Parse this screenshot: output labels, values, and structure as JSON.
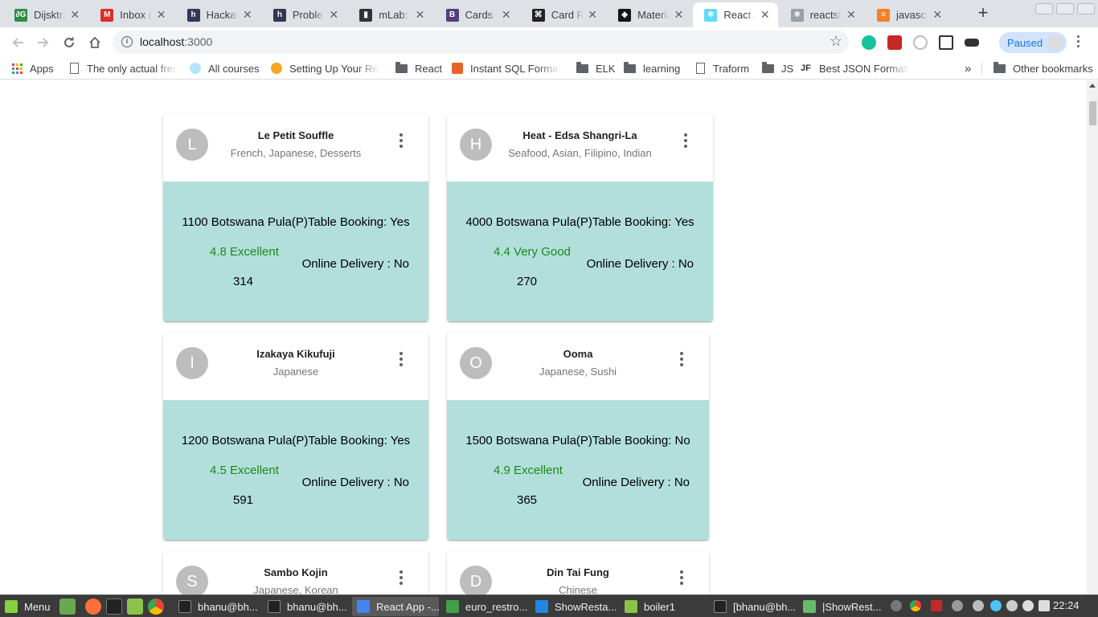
{
  "browser": {
    "tabs": [
      {
        "title": "Dijsktra",
        "favicon": "geeksforgeeks-icon",
        "color": "#2f8d46",
        "glyph": "∂G"
      },
      {
        "title": "Inbox (2",
        "favicon": "gmail-icon",
        "color": "#d93025",
        "glyph": "M"
      },
      {
        "title": "Hackath",
        "favicon": "hackerearth-icon",
        "color": "#323754",
        "glyph": "h"
      },
      {
        "title": "Problem",
        "favicon": "hackerearth-icon",
        "color": "#323754",
        "glyph": "h"
      },
      {
        "title": "mLab: C",
        "favicon": "mlab-icon",
        "color": "#333",
        "glyph": "▮"
      },
      {
        "title": "Cards - I",
        "favicon": "bootstrap-icon",
        "color": "#563d7c",
        "glyph": "B"
      },
      {
        "title": "Card Re",
        "favicon": "github-icon",
        "color": "#222",
        "glyph": "⌘"
      },
      {
        "title": "Materia",
        "favicon": "codesandbox-icon",
        "color": "#151515",
        "glyph": "◈"
      },
      {
        "title": "React A",
        "favicon": "react-icon",
        "color": "#61dafb",
        "glyph": "⚛",
        "active": true
      },
      {
        "title": "reactstr",
        "favicon": "react-icon",
        "color": "#9aa0a6",
        "glyph": "⚛"
      },
      {
        "title": "javascri",
        "favicon": "stackoverflow-icon",
        "color": "#f48024",
        "glyph": "≡"
      }
    ],
    "url_host": "localhost",
    "url_port": ":3000",
    "profile_label": "Paused",
    "bookmarks": [
      {
        "label": "Apps",
        "icon": "apps-grid-icon"
      },
      {
        "label": "The only actual free",
        "icon": "page-icon"
      },
      {
        "label": "All courses",
        "icon": "idea-icon"
      },
      {
        "label": "Setting Up Your Rea",
        "icon": "orange-icon"
      },
      {
        "label": "React",
        "icon": "folder-icon"
      },
      {
        "label": "Instant SQL Formatt",
        "icon": "sql-icon"
      },
      {
        "label": "ELK",
        "icon": "folder-icon"
      },
      {
        "label": "learning",
        "icon": "folder-icon"
      },
      {
        "label": "Traform",
        "icon": "page-icon"
      },
      {
        "label": "JS",
        "icon": "folder-icon"
      },
      {
        "label": "Best JSON Formatte",
        "icon": "jsonformatter-icon"
      }
    ],
    "bookmarks_overflow": "»",
    "other_bookmarks": "Other bookmarks"
  },
  "restaurants": [
    {
      "initial": "L",
      "name": "Le Petit Souffle",
      "cuisines": "French, Japanese, Desserts",
      "price_line": "1100 Botswana Pula(P)Table Booking: Yes",
      "rating": "4.8 Excellent",
      "delivery": "Online Delivery : No",
      "votes": "314"
    },
    {
      "initial": "H",
      "name": "Heat - Edsa Shangri-La",
      "cuisines": "Seafood, Asian, Filipino, Indian",
      "price_line": "4000 Botswana Pula(P)Table Booking: Yes",
      "rating": "4.4 Very Good",
      "delivery": "Online Delivery : No",
      "votes": "270"
    },
    {
      "initial": "I",
      "name": "Izakaya Kikufuji",
      "cuisines": "Japanese",
      "price_line": "1200 Botswana Pula(P)Table Booking: Yes",
      "rating": "4.5 Excellent",
      "delivery": "Online Delivery : No",
      "votes": "591"
    },
    {
      "initial": "O",
      "name": "Ooma",
      "cuisines": "Japanese, Sushi",
      "price_line": "1500 Botswana Pula(P)Table Booking: No",
      "rating": "4.9 Excellent",
      "delivery": "Online Delivery : No",
      "votes": "365"
    },
    {
      "initial": "S",
      "name": "Sambo Kojin",
      "cuisines": "Japanese, Korean"
    },
    {
      "initial": "D",
      "name": "Din Tai Fung",
      "cuisines": "Chinese"
    }
  ],
  "colors": {
    "card_body": "#b2dfdb",
    "rating_green": "#1b8a1b",
    "avatar_grey": "#bdbdbd",
    "accent_blue": "#1a73e8"
  },
  "taskbar": {
    "menu_label": "Menu",
    "items": [
      {
        "label": "bhanu@bh...",
        "icon": "terminal-icon"
      },
      {
        "label": "bhanu@bh...",
        "icon": "terminal-icon"
      },
      {
        "label": "React App -...",
        "icon": "chrome-icon",
        "active": true
      },
      {
        "label": "euro_restro...",
        "icon": "spreadsheet-icon"
      },
      {
        "label": "ShowResta...",
        "icon": "vscode-icon"
      },
      {
        "label": "boiler1",
        "icon": "folder-icon"
      },
      {
        "label": "[bhanu@bh...",
        "icon": "terminal-icon"
      },
      {
        "label": "|ShowRest...",
        "icon": "editor-icon"
      }
    ],
    "clock": "22:24"
  }
}
